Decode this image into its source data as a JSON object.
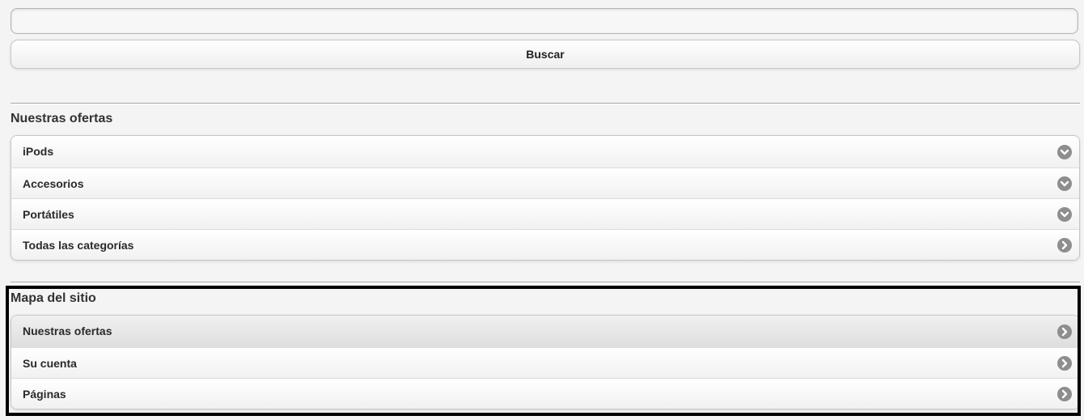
{
  "search": {
    "value": "",
    "placeholder": "",
    "button_label": "Buscar"
  },
  "offers": {
    "title": "Nuestras ofertas",
    "items": [
      {
        "label": "iPods",
        "icon": "chevron-down-icon"
      },
      {
        "label": "Accesorios",
        "icon": "chevron-down-icon"
      },
      {
        "label": "Portátiles",
        "icon": "chevron-down-icon"
      },
      {
        "label": "Todas las categorías",
        "icon": "chevron-right-icon"
      }
    ]
  },
  "sitemap": {
    "title": "Mapa del sitio",
    "items": [
      {
        "label": "Nuestras ofertas",
        "icon": "chevron-right-icon"
      },
      {
        "label": "Su cuenta",
        "icon": "chevron-right-icon"
      },
      {
        "label": "Páginas",
        "icon": "chevron-right-icon"
      }
    ]
  },
  "colors": {
    "icon_bg": "#8e8e8e",
    "highlight_border": "#000000"
  }
}
